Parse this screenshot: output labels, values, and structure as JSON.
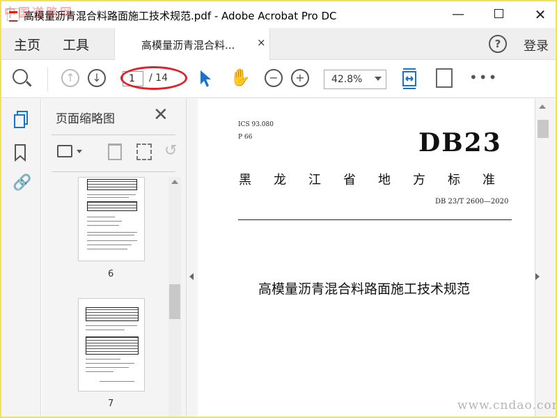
{
  "window": {
    "title": "高模量沥青混合料路面施工技术规范.pdf - Adobe Acrobat Pro DC",
    "minimize_glyph": "—",
    "close_glyph": "✕"
  },
  "watermarks": {
    "top_left": "中国道路网",
    "bottom_right": "www.cndao.com"
  },
  "tabbar": {
    "home": "主页",
    "tools": "工具",
    "doc_tab": "高模量沥青混合料...",
    "doc_tab_close": "×",
    "help_glyph": "?",
    "login": "登录"
  },
  "toolbar": {
    "prev_glyph": "↑",
    "next_glyph": "↓",
    "page_current": "1",
    "page_total": "/ 14",
    "zoom_out_glyph": "−",
    "zoom_in_glyph": "+",
    "zoom_level": "42.8%",
    "more_glyph": "•••",
    "hand_glyph": "✋"
  },
  "left_rail": {
    "attach_glyph": "🔗"
  },
  "thumbnail_panel": {
    "title": "页面缩略图",
    "close_glyph": "✕",
    "undo_glyph": "↺",
    "thumbnails": [
      {
        "page_number": "6"
      },
      {
        "page_number": "7"
      }
    ]
  },
  "document": {
    "ics": "ICS 93.080",
    "p_code": "P 66",
    "db_code": "DB23",
    "province": "黑龙江省地方标准",
    "standard_number": "DB 23/T 2600—2020",
    "title": "高模量沥青混合料路面施工技术规范"
  },
  "colors": {
    "accent_blue": "#1a73c8",
    "highlight_red": "#e0202a",
    "frame_yellow": "#f2e15a"
  },
  "icons": [
    "search-icon",
    "up-arrow-icon",
    "down-arrow-icon",
    "cursor-icon",
    "hand-icon",
    "zoom-out-icon",
    "zoom-in-icon",
    "fit-page-icon",
    "rotate-icon",
    "more-icon",
    "pages-icon",
    "bookmark-icon",
    "attachment-icon",
    "options-icon",
    "trash-icon",
    "extract-icon",
    "undo-icon"
  ]
}
